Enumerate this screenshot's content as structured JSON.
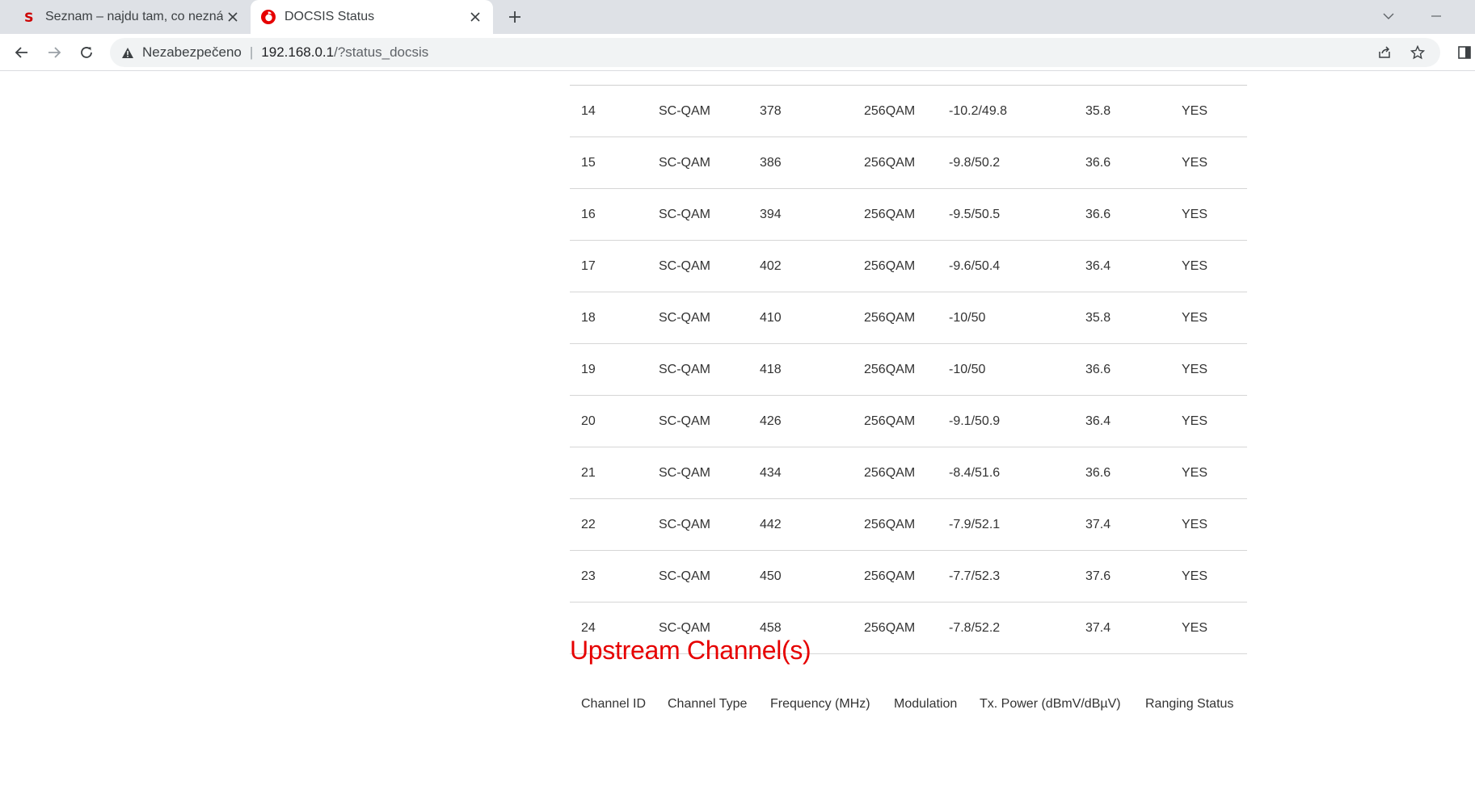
{
  "browser": {
    "tabs": [
      {
        "title": "Seznam – najdu tam, co neznám",
        "favicon": "seznam-s-icon",
        "active": false
      },
      {
        "title": "DOCSIS Status",
        "favicon": "vodafone-icon",
        "active": true
      }
    ],
    "security_label": "Nezabezpečeno",
    "url_host": "192.168.0.1",
    "url_path": "/?status_docsis"
  },
  "downstream": {
    "rows": [
      {
        "id": "14",
        "type": "SC-QAM",
        "freq": "378",
        "mod": "256QAM",
        "power": "-10.2/49.8",
        "snr": "35.8",
        "locked": "YES"
      },
      {
        "id": "15",
        "type": "SC-QAM",
        "freq": "386",
        "mod": "256QAM",
        "power": "-9.8/50.2",
        "snr": "36.6",
        "locked": "YES"
      },
      {
        "id": "16",
        "type": "SC-QAM",
        "freq": "394",
        "mod": "256QAM",
        "power": "-9.5/50.5",
        "snr": "36.6",
        "locked": "YES"
      },
      {
        "id": "17",
        "type": "SC-QAM",
        "freq": "402",
        "mod": "256QAM",
        "power": "-9.6/50.4",
        "snr": "36.4",
        "locked": "YES"
      },
      {
        "id": "18",
        "type": "SC-QAM",
        "freq": "410",
        "mod": "256QAM",
        "power": "-10/50",
        "snr": "35.8",
        "locked": "YES"
      },
      {
        "id": "19",
        "type": "SC-QAM",
        "freq": "418",
        "mod": "256QAM",
        "power": "-10/50",
        "snr": "36.6",
        "locked": "YES"
      },
      {
        "id": "20",
        "type": "SC-QAM",
        "freq": "426",
        "mod": "256QAM",
        "power": "-9.1/50.9",
        "snr": "36.4",
        "locked": "YES"
      },
      {
        "id": "21",
        "type": "SC-QAM",
        "freq": "434",
        "mod": "256QAM",
        "power": "-8.4/51.6",
        "snr": "36.6",
        "locked": "YES"
      },
      {
        "id": "22",
        "type": "SC-QAM",
        "freq": "442",
        "mod": "256QAM",
        "power": "-7.9/52.1",
        "snr": "37.4",
        "locked": "YES"
      },
      {
        "id": "23",
        "type": "SC-QAM",
        "freq": "450",
        "mod": "256QAM",
        "power": "-7.7/52.3",
        "snr": "37.6",
        "locked": "YES"
      },
      {
        "id": "24",
        "type": "SC-QAM",
        "freq": "458",
        "mod": "256QAM",
        "power": "-7.8/52.2",
        "snr": "37.4",
        "locked": "YES"
      }
    ]
  },
  "upstream": {
    "title": "Upstream Channel(s)",
    "headers": [
      "Channel ID",
      "Channel Type",
      "Frequency (MHz)",
      "Modulation",
      "Tx. Power (dBmV/dBµV)",
      "Ranging Status"
    ]
  },
  "colors": {
    "accent": "#e60000",
    "text": "#333333",
    "row_border": "#d6d6d6",
    "tabstrip": "#dee1e6"
  }
}
